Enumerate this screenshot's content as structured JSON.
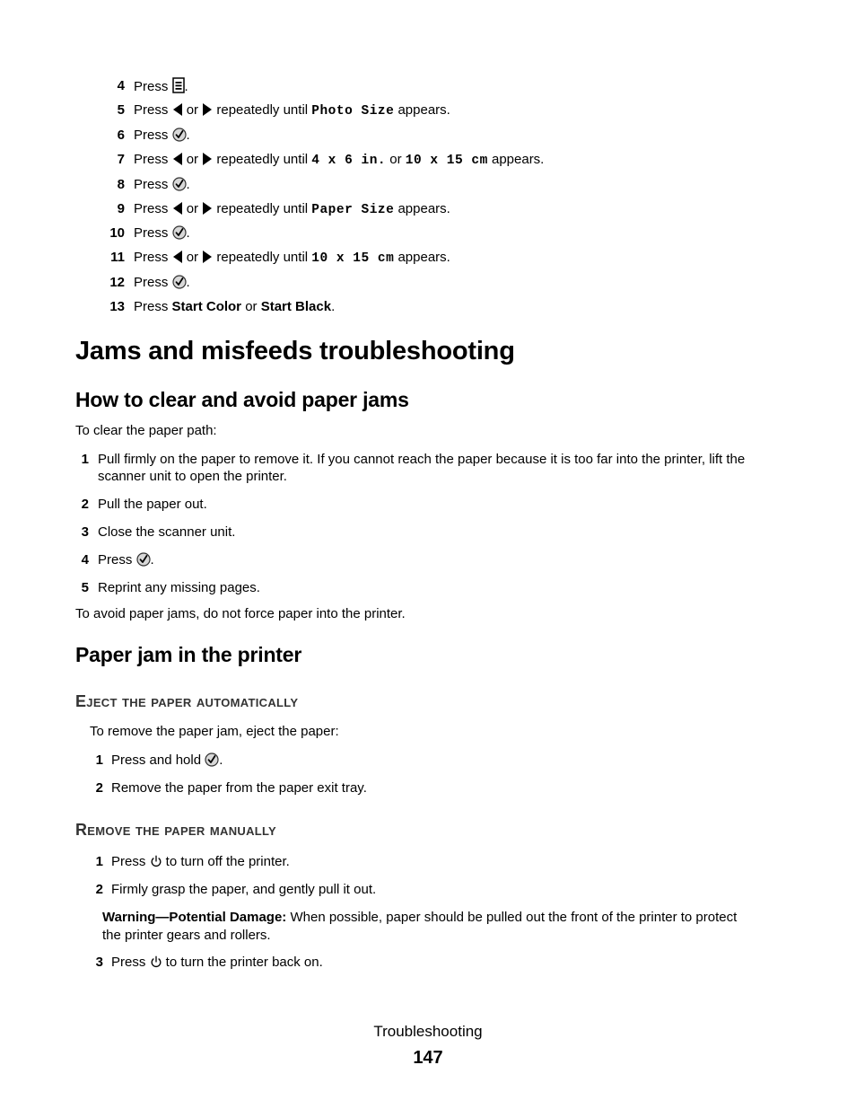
{
  "top_steps": [
    {
      "num": "4",
      "pre": "Press ",
      "icon": "menu-icon",
      "post": "."
    },
    {
      "num": "5",
      "pre": "Press ",
      "icon": "arrows",
      "mid": " repeatedly until ",
      "code": "Photo Size",
      "post": " appears."
    },
    {
      "num": "6",
      "pre": "Press ",
      "icon": "select-icon",
      "post": "."
    },
    {
      "num": "7",
      "pre": "Press ",
      "icon": "arrows",
      "mid": " repeatedly until ",
      "code": "4 x 6 in.",
      "or": " or ",
      "code2": "10 x 15 cm",
      "post": " appears."
    },
    {
      "num": "8",
      "pre": "Press ",
      "icon": "select-icon",
      "post": "."
    },
    {
      "num": "9",
      "pre": "Press ",
      "icon": "arrows",
      "mid": " repeatedly until ",
      "code": "Paper Size",
      "post": " appears."
    },
    {
      "num": "10",
      "pre": "Press ",
      "icon": "select-icon",
      "post": "."
    },
    {
      "num": "11",
      "pre": "Press ",
      "icon": "arrows",
      "mid": " repeatedly until ",
      "code": "10 x 15 cm",
      "post": " appears."
    },
    {
      "num": "12",
      "pre": "Press ",
      "icon": "select-icon",
      "post": "."
    },
    {
      "num": "13",
      "pre": "Press ",
      "bold1": "Start Color",
      "or": " or ",
      "bold2": "Start Black",
      "post": "."
    }
  ],
  "or_word": "or",
  "h1": "Jams and misfeeds troubleshooting",
  "section1": {
    "title": "How to clear and avoid paper jams",
    "intro": "To clear the paper path:",
    "steps": [
      {
        "num": "1",
        "text": "Pull firmly on the paper to remove it. If you cannot reach the paper because it is too far into the printer, lift the",
        "text2": "scanner unit to open the printer."
      },
      {
        "num": "2",
        "text": "Pull the paper out."
      },
      {
        "num": "3",
        "text": "Close the scanner unit."
      },
      {
        "num": "4",
        "pre": "Press ",
        "post": "."
      },
      {
        "num": "5",
        "text": "Reprint any missing pages."
      }
    ],
    "outro": "To avoid paper jams, do not force paper into the printer."
  },
  "section2": {
    "title": "Paper jam in the printer",
    "sub1": {
      "title": "Eject the paper automatically",
      "intro": "To remove the paper jam, eject the paper:",
      "steps": [
        {
          "num": "1",
          "pre": "Press and hold ",
          "post": "."
        },
        {
          "num": "2",
          "text": "Remove the paper from the paper exit tray."
        }
      ]
    },
    "sub2": {
      "title": "Remove the paper manually",
      "steps": [
        {
          "num": "1",
          "pre": "Press ",
          "post": " to turn off the printer."
        },
        {
          "num": "2",
          "text": "Firmly grasp the paper, and gently pull it out."
        },
        {
          "num": "3",
          "pre": "Press ",
          "post": " to turn the printer back on."
        }
      ],
      "warning_label": "Warning—Potential Damage:",
      "warning_text": " When possible, paper should be pulled out the front of the printer to protect",
      "warning_text2": "the printer gears and rollers."
    }
  },
  "footer": {
    "section": "Troubleshooting",
    "page": "147"
  }
}
